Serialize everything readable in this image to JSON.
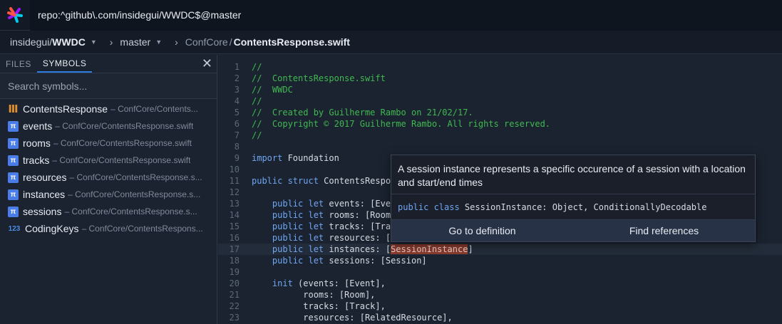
{
  "search": {
    "query": "repo:^github\\.com/insidegui/WWDC$@master"
  },
  "breadcrumb": {
    "owner": "insidegui/",
    "repo": "WWDC",
    "branch": "master",
    "folder": "ConfCore",
    "slash": "/",
    "file": "ContentsResponse.swift"
  },
  "sidebar": {
    "tabs": [
      "FILES",
      "SYMBOLS"
    ],
    "active_tab": "SYMBOLS",
    "search_placeholder": "Search symbols...",
    "symbols": [
      {
        "icon": "struct-icon",
        "name": "ContentsResponse",
        "path": "– ConfCore/Contents..."
      },
      {
        "icon": "property-icon",
        "name": "events",
        "path": "– ConfCore/ContentsResponse.swift"
      },
      {
        "icon": "property-icon",
        "name": "rooms",
        "path": "– ConfCore/ContentsResponse.swift"
      },
      {
        "icon": "property-icon",
        "name": "tracks",
        "path": "– ConfCore/ContentsResponse.swift"
      },
      {
        "icon": "property-icon",
        "name": "resources",
        "path": "– ConfCore/ContentsResponse.s..."
      },
      {
        "icon": "property-icon",
        "name": "instances",
        "path": "– ConfCore/ContentsResponse.s..."
      },
      {
        "icon": "property-icon",
        "name": "sessions",
        "path": "– ConfCore/ContentsResponse.s..."
      },
      {
        "icon": "enum-icon",
        "name": "CodingKeys",
        "path": "– ConfCore/ContentsRespons..."
      }
    ]
  },
  "code": {
    "lines": [
      {
        "n": "1",
        "parts": [
          [
            "cm",
            "//"
          ]
        ]
      },
      {
        "n": "2",
        "parts": [
          [
            "cm",
            "//  ContentsResponse.swift"
          ]
        ]
      },
      {
        "n": "3",
        "parts": [
          [
            "cm",
            "//  WWDC"
          ]
        ]
      },
      {
        "n": "4",
        "parts": [
          [
            "cm",
            "//"
          ]
        ]
      },
      {
        "n": "5",
        "parts": [
          [
            "cm",
            "//  Created by Guilherme Rambo on 21/02/17."
          ]
        ]
      },
      {
        "n": "6",
        "parts": [
          [
            "cm",
            "//  Copyright © 2017 Guilherme Rambo. All rights reserved."
          ]
        ]
      },
      {
        "n": "7",
        "parts": [
          [
            "cm",
            "//"
          ]
        ]
      },
      {
        "n": "8",
        "parts": []
      },
      {
        "n": "9",
        "parts": [
          [
            "kw",
            "import"
          ],
          [
            "",
            " Foundation"
          ]
        ]
      },
      {
        "n": "10",
        "parts": []
      },
      {
        "n": "11",
        "parts": [
          [
            "kw",
            "public struct"
          ],
          [
            "",
            " ContentsRespo"
          ]
        ]
      },
      {
        "n": "12",
        "parts": []
      },
      {
        "n": "13",
        "parts": [
          [
            "",
            "    "
          ],
          [
            "kw",
            "public let"
          ],
          [
            "",
            " events: [Eve"
          ]
        ]
      },
      {
        "n": "14",
        "parts": [
          [
            "",
            "    "
          ],
          [
            "kw",
            "public let"
          ],
          [
            "",
            " rooms: [Room"
          ]
        ]
      },
      {
        "n": "15",
        "parts": [
          [
            "",
            "    "
          ],
          [
            "kw",
            "public let"
          ],
          [
            "",
            " tracks: [Tra"
          ]
        ]
      },
      {
        "n": "16",
        "parts": [
          [
            "",
            "    "
          ],
          [
            "kw",
            "public let"
          ],
          [
            "",
            " resources: ["
          ]
        ]
      },
      {
        "n": "17",
        "parts": [
          [
            "",
            "    "
          ],
          [
            "kw",
            "public let"
          ],
          [
            "",
            " instances: ["
          ],
          [
            "hl",
            "SessionInstance"
          ],
          [
            "",
            "]"
          ]
        ]
      },
      {
        "n": "18",
        "parts": [
          [
            "",
            "    "
          ],
          [
            "kw",
            "public let"
          ],
          [
            "",
            " sessions: [Session]"
          ]
        ]
      },
      {
        "n": "19",
        "parts": []
      },
      {
        "n": "20",
        "parts": [
          [
            "",
            "    "
          ],
          [
            "kw",
            "init"
          ],
          [
            "",
            " (events: [Event],"
          ]
        ]
      },
      {
        "n": "21",
        "parts": [
          [
            "",
            "          rooms: [Room],"
          ]
        ]
      },
      {
        "n": "22",
        "parts": [
          [
            "",
            "          tracks: [Track],"
          ]
        ]
      },
      {
        "n": "23",
        "parts": [
          [
            "",
            "          resources: [RelatedResource],"
          ]
        ]
      }
    ]
  },
  "popup": {
    "doc": "A session instance represents a specific occurence of a session with a location and start/end times",
    "sig_kw": "public class",
    "sig_rest": " SessionInstance: Object, ConditionallyDecodable",
    "go_to_definition": "Go to definition",
    "find_references": "Find references"
  },
  "colors": {
    "accent": "#2f7ce0",
    "comment": "#3fb950",
    "keyword": "#6fa6f2",
    "highlight": "#8a3a2e"
  }
}
